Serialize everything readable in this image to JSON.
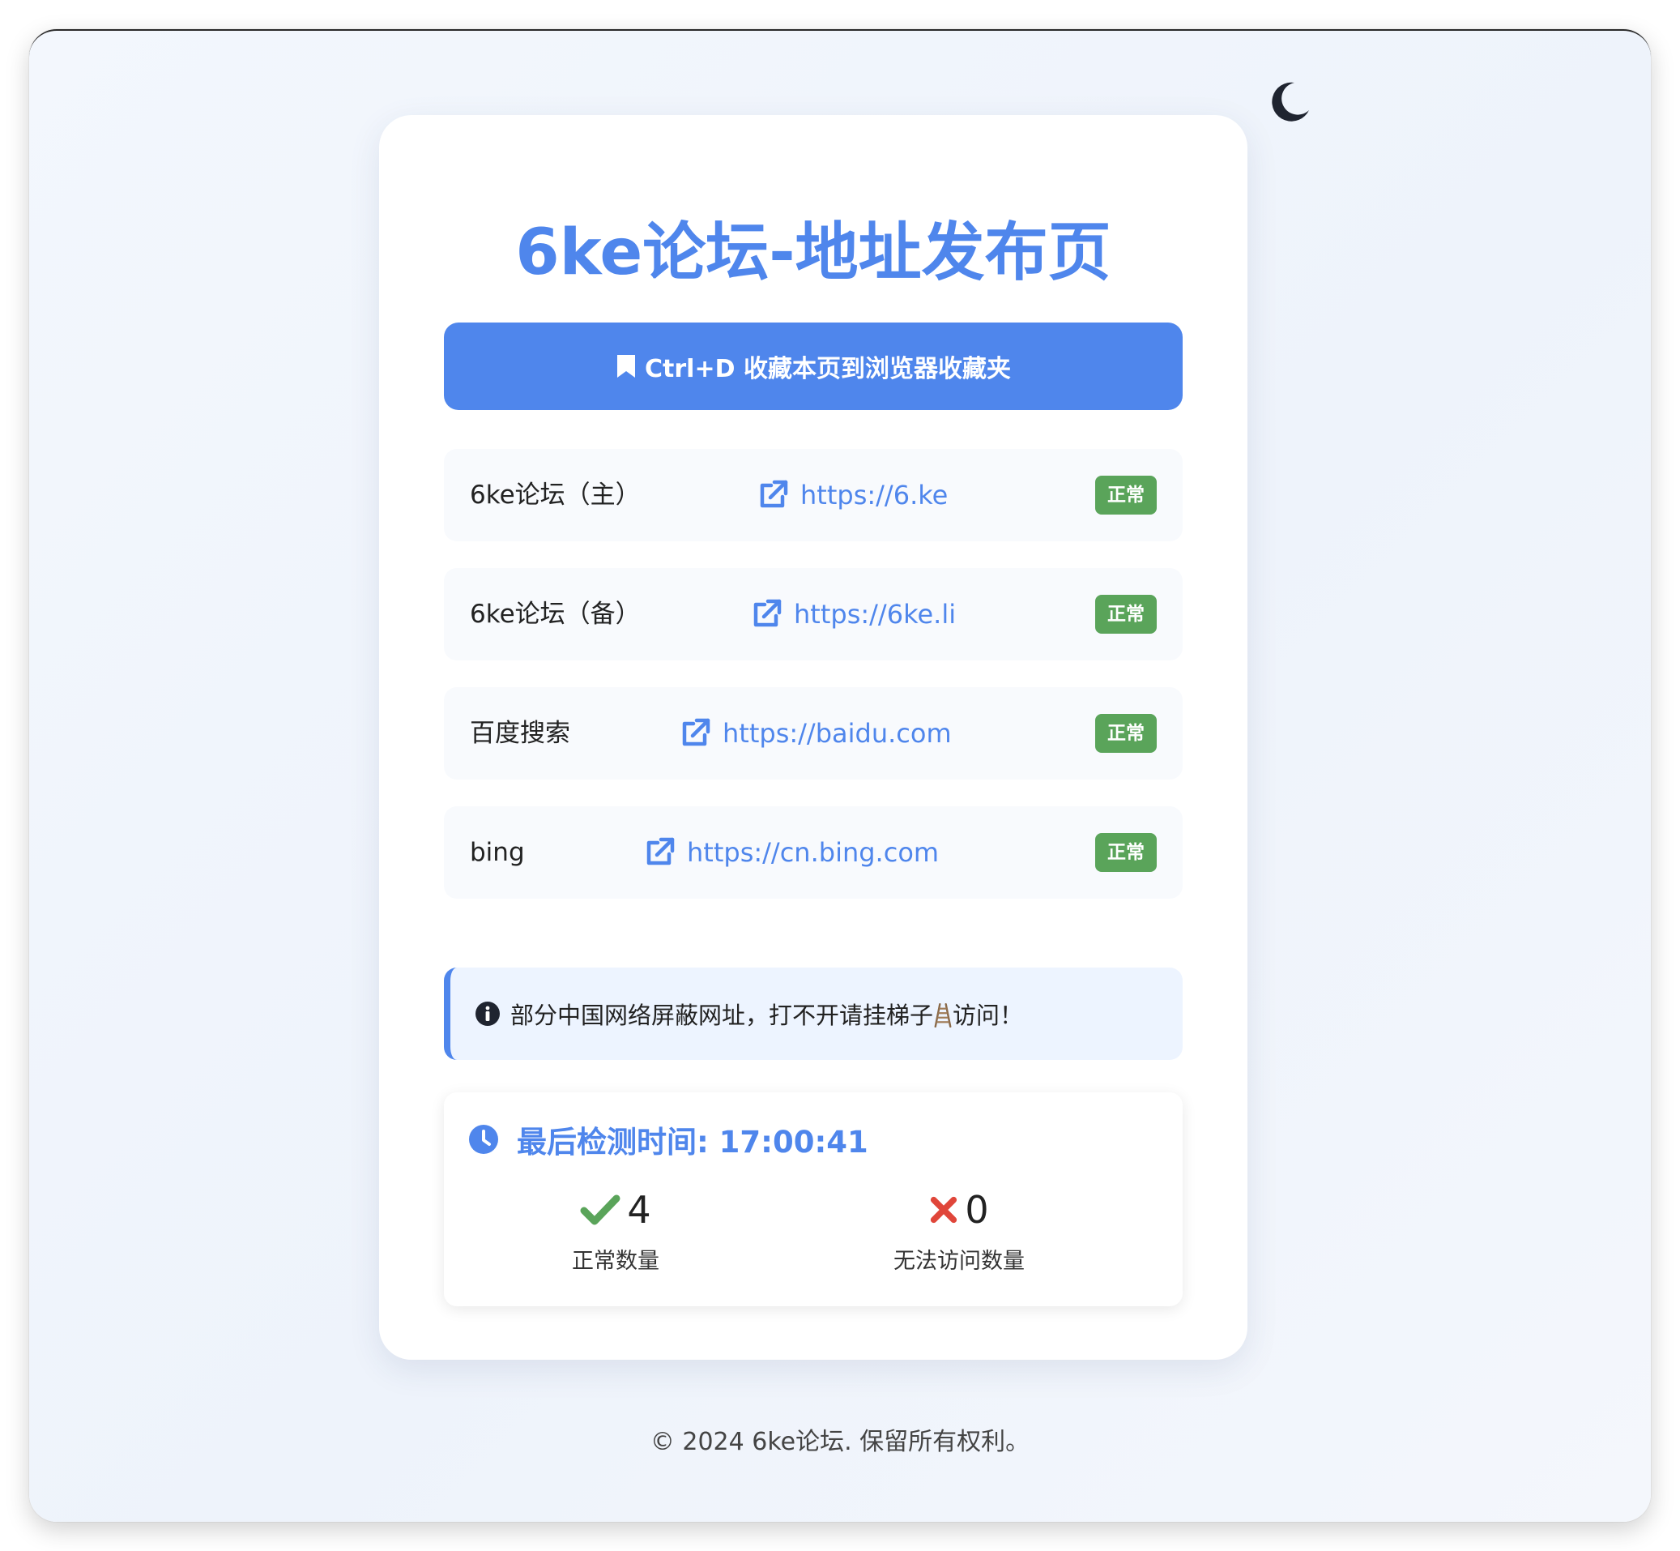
{
  "page": {
    "title": "6ke论坛-地址发布页",
    "bookmark_label": "Ctrl+D 收藏本页到浏览器收藏夹"
  },
  "theme": {
    "toggle_icon": "moon-icon",
    "accent_color": "#4f86ec",
    "ok_color": "#5aa45a",
    "error_color": "#e0463a"
  },
  "links": [
    {
      "name": "6ke论坛（主）",
      "url": "https://6.ke",
      "status": "正常",
      "icon": "external-link-icon"
    },
    {
      "name": "6ke论坛（备）",
      "url": "https://6ke.li",
      "status": "正常",
      "icon": "external-link-icon"
    },
    {
      "name": "百度搜索",
      "url": "https://baidu.com",
      "status": "正常",
      "icon": "external-link-icon"
    },
    {
      "name": "bing",
      "url": "https://cn.bing.com",
      "status": "正常",
      "icon": "external-link-icon"
    }
  ],
  "notice": {
    "text_before": "部分中国网络屏蔽网址，打不开请挂梯子",
    "text_after": "访问！",
    "icon": "info-icon"
  },
  "stats": {
    "header": "最后检测时间: 17:00:41",
    "ok_count": "4",
    "ok_label": "正常数量",
    "fail_count": "0",
    "fail_label": "无法访问数量"
  },
  "footer": {
    "text": "© 2024 6ke论坛. 保留所有权利。"
  }
}
